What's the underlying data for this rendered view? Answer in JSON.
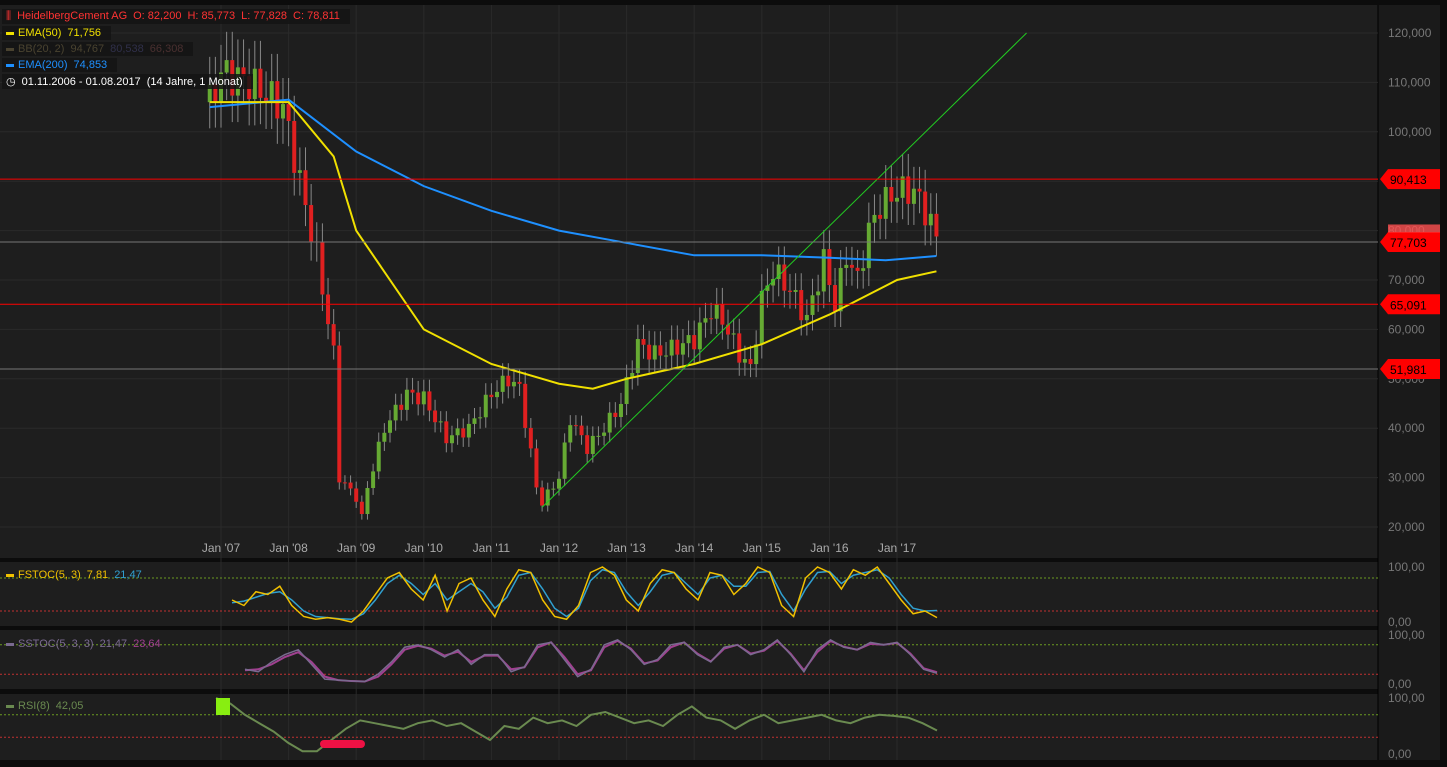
{
  "header": {
    "symbol": "HeidelbergCement AG",
    "open": "O: 82,200",
    "high": "H: 85,773",
    "low": "L: 77,828",
    "close": "C: 78,811"
  },
  "legend": {
    "ema50": {
      "label": "EMA(50)",
      "value": "71,756",
      "color": "#f0e000"
    },
    "bb": {
      "label": "BB(20, 2)",
      "upper": "94,767",
      "mid": "80,538",
      "lower": "66,308"
    },
    "ema200": {
      "label": "EMA(200)",
      "value": "74,853",
      "color": "#1e90ff"
    },
    "range": {
      "dates": "01.11.2006 - 01.08.2017",
      "span": "(14 Jahre, 1 Monat)"
    }
  },
  "indicators": {
    "fstoc": {
      "label": "FSTOC(5, 3)",
      "k": "7,81",
      "d": "21,47"
    },
    "sstoc": {
      "label": "SSTOC(5, 3, 3)",
      "k": "21,47",
      "d": "23,64"
    },
    "rsi": {
      "label": "RSI(8)",
      "value": "42,05"
    }
  },
  "chart_data": {
    "type": "candlestick",
    "title": "HeidelbergCement AG",
    "x_ticks": [
      "Jan '07",
      "Jan '08",
      "Jan '09",
      "Jan '10",
      "Jan '11",
      "Jan '12",
      "Jan '13",
      "Jan '14",
      "Jan '15",
      "Jan '16",
      "Jan '17"
    ],
    "y_ticks": [
      "20,000",
      "30,000",
      "40,000",
      "50,000",
      "60,000",
      "70,000",
      "80,000",
      "90,000",
      "100,000",
      "110,000",
      "120,000"
    ],
    "ylim": [
      20000,
      120000
    ],
    "price_keypoints_month_from_jan07": [
      [
        -2,
        106000
      ],
      [
        0,
        112000
      ],
      [
        5,
        110000
      ],
      [
        11,
        105000
      ],
      [
        14,
        90000
      ],
      [
        17,
        75000
      ],
      [
        20,
        55000
      ],
      [
        21,
        30000
      ],
      [
        24,
        26000
      ],
      [
        25,
        22000
      ],
      [
        26,
        28000
      ],
      [
        29,
        40000
      ],
      [
        33,
        47000
      ],
      [
        36,
        46000
      ],
      [
        40,
        38000
      ],
      [
        44,
        40000
      ],
      [
        48,
        47000
      ],
      [
        51,
        50000
      ],
      [
        53,
        48000
      ],
      [
        55,
        35000
      ],
      [
        56,
        28000
      ],
      [
        57,
        25000
      ],
      [
        60,
        30000
      ],
      [
        62,
        42000
      ],
      [
        65,
        36000
      ],
      [
        68,
        40000
      ],
      [
        71,
        45000
      ],
      [
        74,
        57000
      ],
      [
        77,
        55000
      ],
      [
        80,
        56000
      ],
      [
        84,
        58000
      ],
      [
        87,
        64000
      ],
      [
        89,
        62000
      ],
      [
        92,
        55000
      ],
      [
        94,
        52000
      ],
      [
        96,
        66000
      ],
      [
        98,
        72000
      ],
      [
        101,
        68000
      ],
      [
        104,
        62000
      ],
      [
        107,
        74000
      ],
      [
        109,
        65000
      ],
      [
        111,
        75000
      ],
      [
        113,
        70000
      ],
      [
        115,
        80000
      ],
      [
        117,
        85000
      ],
      [
        120,
        88000
      ],
      [
        123,
        88000
      ],
      [
        125,
        84000
      ],
      [
        127,
        78811
      ]
    ],
    "ema50": [
      [
        -2,
        106000
      ],
      [
        12,
        106000
      ],
      [
        20,
        95000
      ],
      [
        24,
        80000
      ],
      [
        36,
        60000
      ],
      [
        48,
        53000
      ],
      [
        60,
        49000
      ],
      [
        66,
        48000
      ],
      [
        72,
        50000
      ],
      [
        84,
        53000
      ],
      [
        96,
        57000
      ],
      [
        108,
        63000
      ],
      [
        120,
        70000
      ],
      [
        127,
        71756
      ]
    ],
    "ema200": [
      [
        -2,
        105000
      ],
      [
        12,
        106500
      ],
      [
        24,
        96000
      ],
      [
        36,
        89000
      ],
      [
        48,
        84000
      ],
      [
        60,
        80000
      ],
      [
        72,
        77500
      ],
      [
        84,
        75000
      ],
      [
        96,
        75000
      ],
      [
        108,
        74500
      ],
      [
        118,
        74000
      ],
      [
        127,
        74853
      ]
    ],
    "horizontal_levels": [
      {
        "value": 90413,
        "label": "90,413",
        "color": "#ff0000"
      },
      {
        "value": 77703,
        "label": "77,703",
        "color": "#ff0000"
      },
      {
        "value": 65091,
        "label": "65,091",
        "color": "#ff0000"
      },
      {
        "value": 51981,
        "label": "51,981",
        "color": "#ff0000"
      }
    ],
    "last_close_label": "78,811",
    "trendline": [
      [
        57,
        24000
      ],
      [
        143,
        120000
      ]
    ],
    "osc_ticks": [
      "100,00",
      "0,00"
    ],
    "fstoc_k": [
      40,
      30,
      55,
      50,
      65,
      30,
      10,
      5,
      8,
      5,
      0,
      20,
      50,
      80,
      90,
      60,
      40,
      85,
      20,
      70,
      80,
      40,
      10,
      60,
      95,
      90,
      40,
      10,
      5,
      30,
      90,
      100,
      85,
      40,
      20,
      70,
      95,
      90,
      60,
      40,
      90,
      85,
      50,
      70,
      100,
      90,
      30,
      10,
      80,
      100,
      90,
      60,
      95,
      85,
      100,
      70,
      40,
      15,
      20,
      8
    ],
    "fstoc_d": [
      35,
      38,
      45,
      52,
      55,
      40,
      20,
      10,
      8,
      6,
      5,
      15,
      40,
      70,
      85,
      70,
      50,
      70,
      40,
      55,
      70,
      55,
      25,
      45,
      85,
      90,
      60,
      25,
      10,
      25,
      75,
      95,
      90,
      55,
      30,
      55,
      85,
      90,
      70,
      50,
      80,
      85,
      65,
      65,
      90,
      92,
      50,
      20,
      60,
      90,
      92,
      70,
      85,
      90,
      95,
      80,
      50,
      25,
      20,
      21
    ],
    "sstoc_k": [
      30,
      25,
      45,
      60,
      70,
      40,
      10,
      8,
      6,
      5,
      20,
      45,
      75,
      80,
      70,
      55,
      70,
      40,
      60,
      60,
      25,
      35,
      80,
      85,
      50,
      15,
      30,
      80,
      90,
      70,
      40,
      50,
      80,
      85,
      60,
      45,
      75,
      80,
      60,
      70,
      90,
      60,
      25,
      70,
      90,
      75,
      70,
      85,
      80,
      85,
      60,
      30,
      22
    ],
    "sstoc_d": [
      28,
      30,
      40,
      55,
      65,
      45,
      15,
      8,
      6,
      5,
      15,
      40,
      70,
      78,
      72,
      58,
      66,
      45,
      58,
      58,
      30,
      34,
      75,
      85,
      55,
      20,
      28,
      75,
      88,
      72,
      42,
      48,
      75,
      85,
      62,
      46,
      72,
      80,
      62,
      68,
      88,
      62,
      28,
      65,
      88,
      76,
      70,
      82,
      80,
      84,
      62,
      32,
      24
    ],
    "rsi": [
      100,
      90,
      70,
      55,
      40,
      20,
      5,
      5,
      25,
      45,
      60,
      55,
      50,
      45,
      55,
      60,
      50,
      55,
      40,
      25,
      50,
      45,
      65,
      55,
      60,
      50,
      70,
      75,
      65,
      55,
      60,
      50,
      70,
      85,
      65,
      60,
      45,
      60,
      70,
      55,
      60,
      65,
      70,
      60,
      55,
      65,
      70,
      68,
      65,
      55,
      42
    ]
  }
}
